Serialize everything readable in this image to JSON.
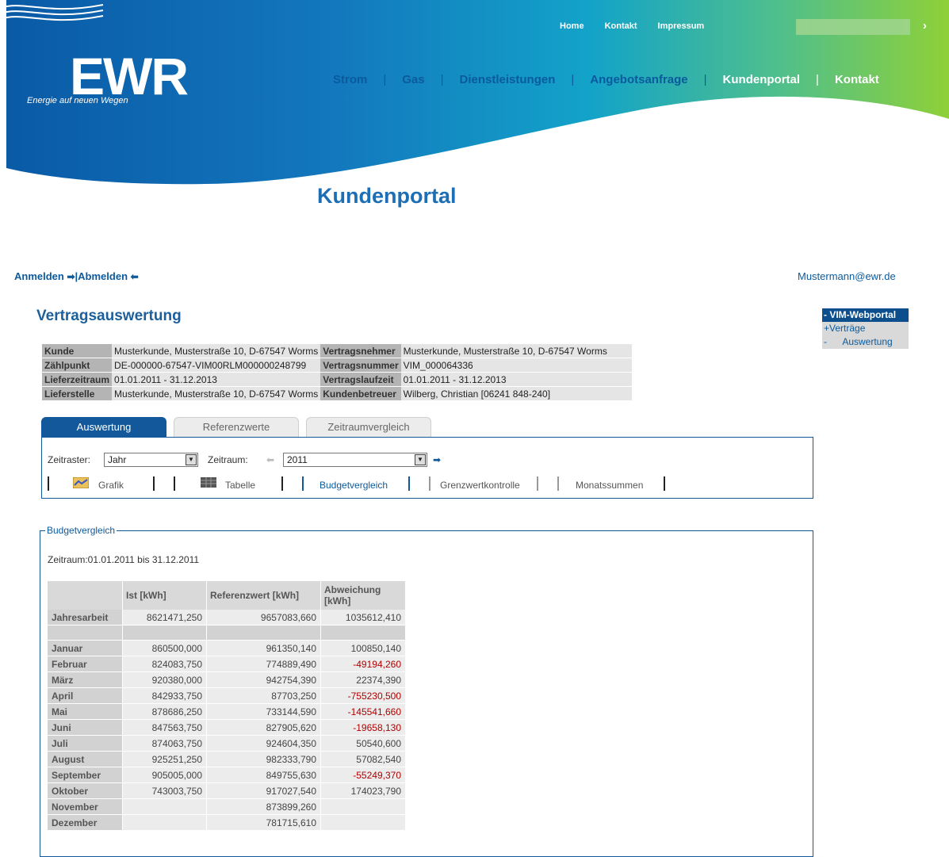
{
  "header": {
    "logo_text": "EWR",
    "logo_tagline": "Energie auf neuen Wegen",
    "top_links": [
      "Home",
      "Kontakt",
      "Impressum"
    ],
    "search_go": "›",
    "main_nav": [
      "Strom",
      "Gas",
      "Dienstleistungen",
      "Angebotsanfrage",
      "Kundenportal",
      "Kontakt"
    ],
    "portal_title": "Kundenportal"
  },
  "auth": {
    "login": "Anmelden",
    "separator": "|",
    "logout": "Abmelden",
    "user_email": "Mustermann@ewr.de"
  },
  "sidebar": {
    "items": [
      "- VIM-Webportal",
      "+Verträge",
      "-      Auswertung"
    ]
  },
  "page": {
    "title": "Vertragsauswertung"
  },
  "contract_info": {
    "rows": [
      [
        "Kunde",
        "Musterkunde, Musterstraße 10, D-67547 Worms",
        "Vertragsnehmer",
        "Musterkunde, Musterstraße 10, D-67547 Worms"
      ],
      [
        "Zählpunkt",
        "DE-000000-67547-VIM00RLM000000248799",
        "Vertragsnummer",
        "VIM_000064336"
      ],
      [
        "Lieferzeitraum",
        "01.01.2011 - 31.12.2013",
        "Vertragslaufzeit",
        "01.01.2011 - 31.12.2013"
      ],
      [
        "Lieferstelle",
        "Musterkunde, Musterstraße 10, D-67547 Worms",
        "Kundenbetreuer",
        "Wilberg, Christian [06241 848-240]"
      ]
    ]
  },
  "tabs": [
    "Auswertung",
    "Referenzwerte",
    "Zeitraumvergleich"
  ],
  "controls": {
    "zeitraster_label": "Zeitraster:",
    "zeitraster_value": "Jahr",
    "zeitraum_label": "Zeitraum:",
    "zeitraum_value": "2011",
    "views": [
      "Grafik",
      "Tabelle",
      "Budgetvergleich",
      "Grenzwertkontrolle",
      "Monatssummen"
    ]
  },
  "budget": {
    "legend": "Budgetvergleich",
    "zeitraum": "Zeitraum:01.01.2011 bis 31.12.2011",
    "headers": [
      "",
      "Ist [kWh]",
      "Referenzwert [kWh]",
      "Abweichung [kWh]"
    ],
    "total": [
      "Jahresarbeit",
      "8621471,250",
      "9657083,660",
      "1035612,410"
    ],
    "months": [
      [
        "Januar",
        "860500,000",
        "961350,140",
        "100850,140"
      ],
      [
        "Februar",
        "824083,750",
        "774889,490",
        "-49194,260"
      ],
      [
        "März",
        "920380,000",
        "942754,390",
        "22374,390"
      ],
      [
        "April",
        "842933,750",
        "87703,250",
        "-755230,500"
      ],
      [
        "Mai",
        "878686,250",
        "733144,590",
        "-145541,660"
      ],
      [
        "Juni",
        "847563,750",
        "827905,620",
        "-19658,130"
      ],
      [
        "Juli",
        "874063,750",
        "924604,350",
        "50540,600"
      ],
      [
        "August",
        "925251,250",
        "982333,790",
        "57082,540"
      ],
      [
        "September",
        "905005,000",
        "849755,630",
        "-55249,370"
      ],
      [
        "Oktober",
        "743003,750",
        "917027,540",
        "174023,790"
      ],
      [
        "November",
        "",
        "873899,260",
        ""
      ],
      [
        "Dezember",
        "",
        "781715,610",
        ""
      ]
    ]
  }
}
